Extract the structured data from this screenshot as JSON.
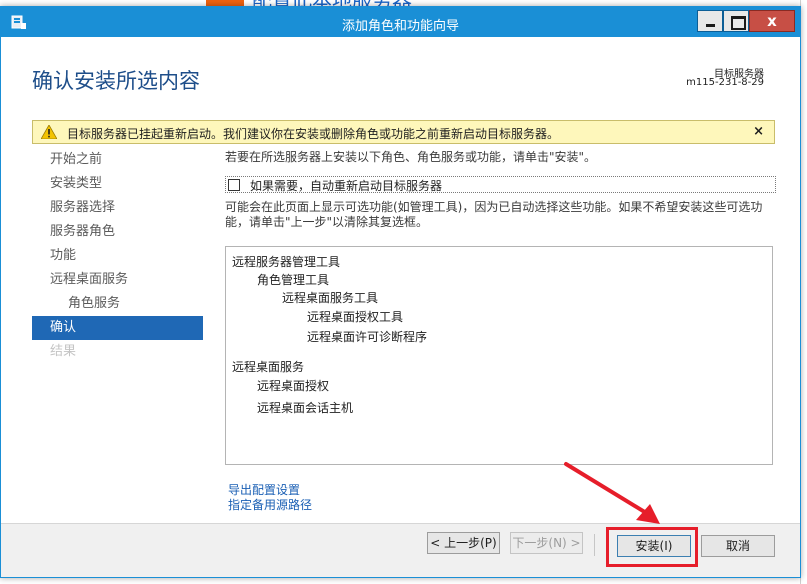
{
  "background": {
    "title_fragment": "配置此本地服务器"
  },
  "window": {
    "title": "添加角色和功能向导",
    "close_glyph": "x"
  },
  "header": {
    "page_title": "确认安装所选内容",
    "destination_label": "目标服务器",
    "destination_value": "m115-231-8-29"
  },
  "warning": {
    "text": "目标服务器已挂起重新启动。我们建议你在安装或删除角色或功能之前重新启动目标服务器。",
    "close": "×"
  },
  "nav": {
    "items": [
      {
        "label": "开始之前",
        "state": "normal"
      },
      {
        "label": "安装类型",
        "state": "normal"
      },
      {
        "label": "服务器选择",
        "state": "normal"
      },
      {
        "label": "服务器角色",
        "state": "normal"
      },
      {
        "label": "功能",
        "state": "normal"
      },
      {
        "label": "远程桌面服务",
        "state": "normal"
      },
      {
        "label": "角色服务",
        "state": "sub"
      },
      {
        "label": "确认",
        "state": "active"
      },
      {
        "label": "结果",
        "state": "disabled"
      }
    ]
  },
  "content": {
    "description": "若要在所选服务器上安装以下角色、角色服务或功能，请单击\"安装\"。",
    "restart_checkbox_label": "如果需要，自动重新启动目标服务器",
    "restart_checked": false,
    "info_text": "可能会在此页面上显示可选功能(如管理工具)，因为已自动选择这些功能。如果不希望安装这些可选功能，请单击\"上一步\"以清除其复选框。",
    "features": [
      "远程服务器管理工具",
      "角色管理工具",
      "远程桌面服务工具",
      "远程桌面授权工具",
      "远程桌面许可诊断程序",
      "远程桌面服务",
      "远程桌面授权",
      "远程桌面会话主机"
    ],
    "export_link": "导出配置设置",
    "source_link": "指定备用源路径"
  },
  "buttons": {
    "prev": "< 上一步(P)",
    "next": "下一步(N) >",
    "install": "安装(I)",
    "cancel": "取消"
  },
  "colors": {
    "titlebar": "#1a8fd6",
    "nav_active": "#1f68b5",
    "warning_bg": "#fef7bb",
    "annotation": "#e61e2a",
    "link": "#1a5fb4"
  }
}
